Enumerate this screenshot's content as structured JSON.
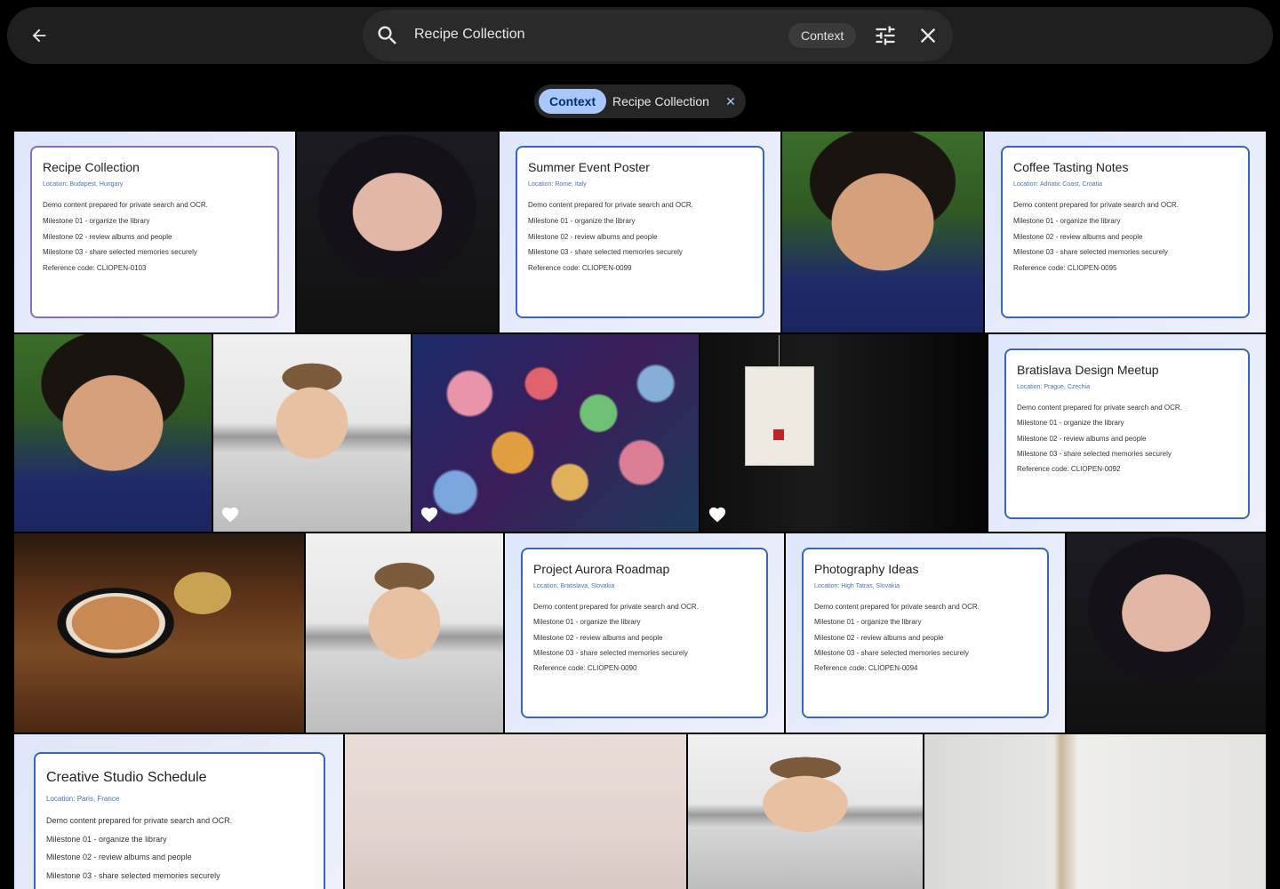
{
  "search": {
    "query": "Recipe Collection",
    "context_label": "Context"
  },
  "filters": {
    "context_chip": "Context",
    "query_chip": "Recipe Collection",
    "remove_symbol": "✕"
  },
  "icons": {
    "back": "arrow-left-icon",
    "search": "search-icon",
    "tune": "tune-icon",
    "close": "close-icon",
    "favorite": "heart-icon"
  },
  "cards": {
    "lines": [
      "Demo content prepared for private search and OCR.",
      "Milestone 01 - organize the library",
      "Milestone 02 - review albums and people",
      "Milestone 03 - share selected memories securely"
    ],
    "recipe": {
      "title": "Recipe Collection",
      "location": "Location: Budapest, Hungary",
      "ref": "Reference code: CLIOPEN-0103"
    },
    "summer": {
      "title": "Summer Event Poster",
      "location": "Location: Rome, Italy",
      "ref": "Reference code: CLIOPEN-0099"
    },
    "coffee": {
      "title": "Coffee Tasting Notes",
      "location": "Location: Adriatic Coast, Croatia",
      "ref": "Reference code: CLIOPEN-0095"
    },
    "bratislava": {
      "title": "Bratislava Design Meetup",
      "location": "Location: Prague, Czechia",
      "ref": "Reference code: CLIOPEN-0092"
    },
    "aurora": {
      "title": "Project Aurora Roadmap",
      "location": "Location: Bratislava, Slovakia",
      "ref": "Reference code: CLIOPEN-0090"
    },
    "photo": {
      "title": "Photography Ideas",
      "location": "Location: High Tatras, Slovakia",
      "ref": "Reference code: CLIOPEN-0094"
    },
    "studio": {
      "title": "Creative Studio Schedule",
      "location": "Location: Paris, France"
    }
  }
}
